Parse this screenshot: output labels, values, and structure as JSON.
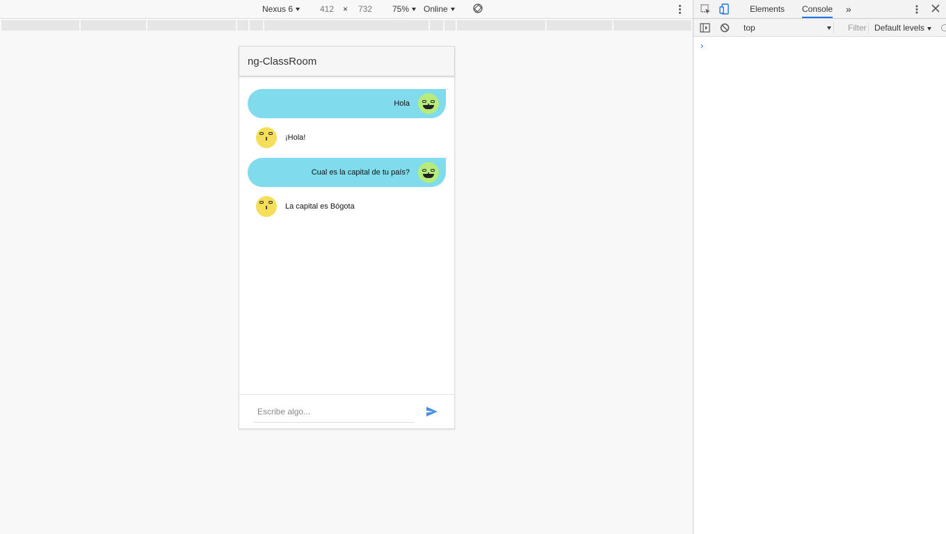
{
  "device_toolbar": {
    "device": "Nexus 6",
    "width": "412",
    "times": "×",
    "height": "732",
    "zoom": "75%",
    "network": "Online"
  },
  "app": {
    "title": "ng-ClassRoom",
    "messages": [
      {
        "direction": "out",
        "text": "Hola"
      },
      {
        "direction": "in",
        "text": "¡Hola!"
      },
      {
        "direction": "out",
        "text": "Cual es la capital de tu país?"
      },
      {
        "direction": "in",
        "text": "La capital es Bógota"
      }
    ],
    "input_placeholder": "Escribe algo..."
  },
  "devtools": {
    "tabs": [
      "Elements",
      "Console"
    ],
    "active_tab": "Console",
    "context": "top",
    "filter_placeholder": "Filter",
    "levels": "Default levels",
    "prompt_symbol": "›"
  },
  "colors": {
    "outgoing_bubble": "#80dcec",
    "avatar_outgoing": "#b7ec7c",
    "avatar_incoming": "#f5df5a",
    "accent": "#1a73e8"
  }
}
